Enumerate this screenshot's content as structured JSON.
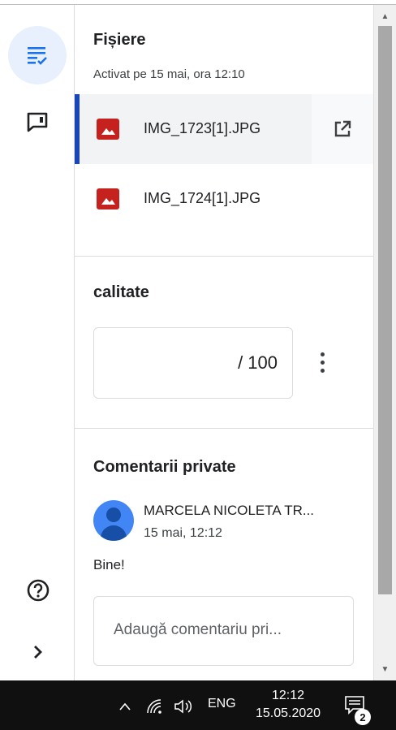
{
  "sidebar": {
    "items": [
      {
        "icon": "assignment-list-icon",
        "active": true
      },
      {
        "icon": "feedback-comment-icon",
        "active": false
      }
    ],
    "bottom": [
      {
        "icon": "help-icon"
      },
      {
        "icon": "chevron-right-icon"
      }
    ]
  },
  "files": {
    "title": "Fișiere",
    "subtitle": "Activat pe 15 mai, ora 12:10",
    "items": [
      {
        "name": "IMG_1723[1].JPG",
        "icon": "image-file-icon",
        "selected": true
      },
      {
        "name": "IMG_1724[1].JPG",
        "icon": "image-file-icon",
        "selected": false
      }
    ]
  },
  "grade": {
    "title": "calitate",
    "value": "/ 100"
  },
  "comments": {
    "title": "Comentarii private",
    "items": [
      {
        "author": "MARCELA NICOLETA TR...",
        "date": "15 mai, 12:12",
        "text": "Bine!"
      }
    ],
    "input_placeholder": "Adaugă comentariu pri..."
  },
  "taskbar": {
    "language": "ENG",
    "time": "12:12",
    "date": "15.05.2020",
    "notification_count": "2"
  },
  "colors": {
    "accent": "#1a47b8",
    "active_bg": "#e8f0fe",
    "file_icon": "#c5221f",
    "avatar": "#4285f4",
    "taskbar": "#101010"
  }
}
